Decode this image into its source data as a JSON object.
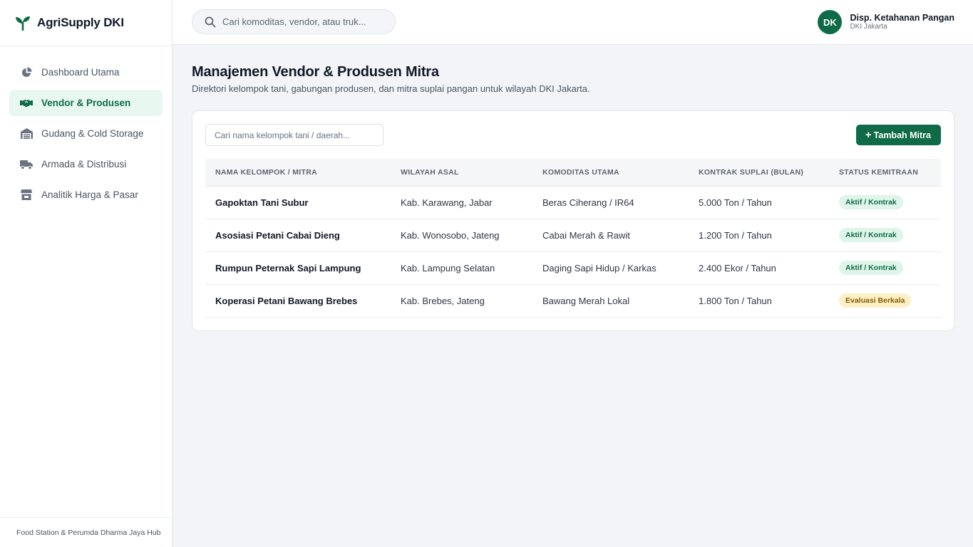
{
  "brand": {
    "title": "AgriSupply DKI"
  },
  "sidebar": {
    "items": [
      {
        "label": "Dashboard Utama",
        "icon": "pie-chart-icon",
        "active": false
      },
      {
        "label": "Vendor & Produsen",
        "icon": "handshake-icon",
        "active": true
      },
      {
        "label": "Gudang & Cold Storage",
        "icon": "warehouse-icon",
        "active": false
      },
      {
        "label": "Armada & Distribusi",
        "icon": "truck-icon",
        "active": false
      },
      {
        "label": "Analitik Harga & Pasar",
        "icon": "store-icon",
        "active": false
      }
    ],
    "footer": "Food Station & Perumda Dharma Jaya Hub"
  },
  "topbar": {
    "search_placeholder": "Cari komoditas, vendor, atau truk...",
    "user": {
      "initials": "DK",
      "name": "Disp. Ketahanan Pangan",
      "role": "DKI Jakarta"
    }
  },
  "page": {
    "title": "Manajemen Vendor & Produsen Mitra",
    "subtitle": "Direktori kelompok tani, gabungan produsen, dan mitra suplai pangan untuk wilayah DKI Jakarta."
  },
  "card": {
    "filter_placeholder": "Cari nama kelompok tani / daerah...",
    "add_label": "Tambah Mitra"
  },
  "table": {
    "headers": [
      "NAMA KELOMPOK / MITRA",
      "WILAYAH ASAL",
      "KOMODITAS UTAMA",
      "KONTRAK SUPLAI (BULAN)",
      "STATUS KEMITRAAN"
    ],
    "rows": [
      {
        "name": "Gapoktan Tani Subur",
        "region": "Kab. Karawang, Jabar",
        "commodity": "Beras Ciherang / IR64",
        "contract": "5.000 Ton / Tahun",
        "status": "Aktif / Kontrak",
        "status_color": "#dff5e9"
      },
      {
        "name": "Asosiasi Petani Cabai Dieng",
        "region": "Kab. Wonosobo, Jateng",
        "commodity": "Cabai Merah & Rawit",
        "contract": "1.200 Ton / Tahun",
        "status": "Aktif / Kontrak",
        "status_color": "#dff5e9"
      },
      {
        "name": "Rumpun Peternak Sapi Lampung",
        "region": "Kab. Lampung Selatan",
        "commodity": "Daging Sapi Hidup / Karkas",
        "contract": "2.400 Ekor / Tahun",
        "status": "Aktif / Kontrak",
        "status_color": "#dff5e9"
      },
      {
        "name": "Koperasi Petani Bawang Brebes",
        "region": "Kab. Brebes, Jateng",
        "commodity": "Bawang Merah Lokal",
        "contract": "1.800 Ton / Tahun",
        "status": "Evaluasi Berkala",
        "status_color": "#fdf0c6"
      }
    ]
  },
  "colors": {
    "brand": "#0f6b47",
    "active_bg": "#e8f7ef",
    "badge_active": "#dff5e9",
    "badge_eval": "#fdf0c6"
  }
}
